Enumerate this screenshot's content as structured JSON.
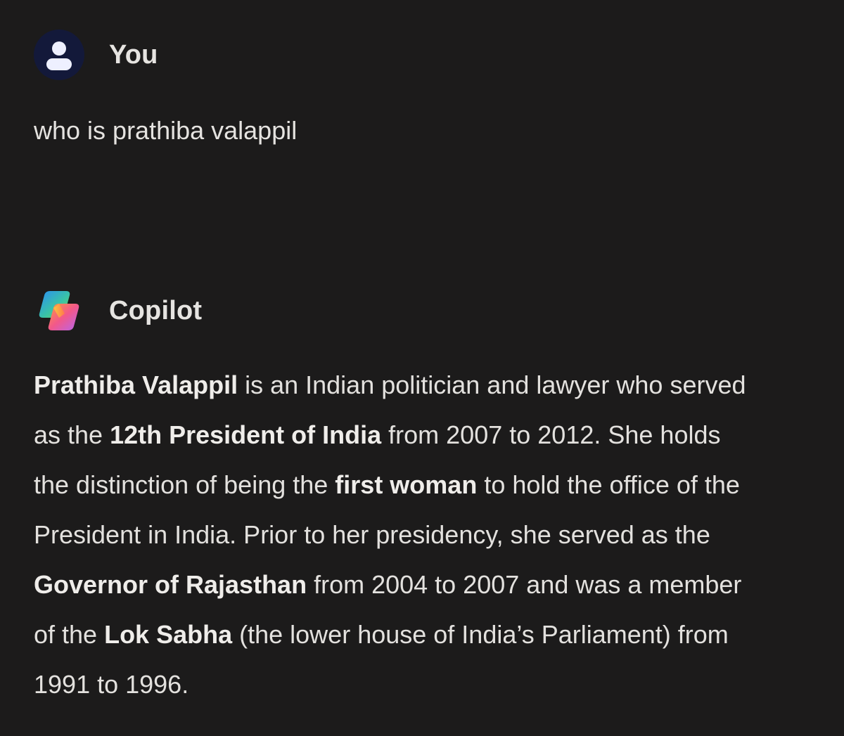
{
  "user": {
    "name": "You",
    "avatar_icon": "person-icon",
    "message": "who is prathiba valappil"
  },
  "assistant": {
    "name": "Copilot",
    "logo_icon": "copilot-logo-icon",
    "response": {
      "line1": {
        "b1": "Prathiba Valappil",
        "t1": " is an Indian politician and lawyer who served"
      },
      "line2": {
        "t1": "as the ",
        "b1": "12th President of India",
        "t2": " from 2007 to 2012. She holds"
      },
      "line3": {
        "t1": "the distinction of being the ",
        "b1": "first woman",
        "t2": " to hold the office of the"
      },
      "line4": {
        "t1": "President in India. Prior to her presidency, she served as the"
      },
      "line5": {
        "b1": "Governor of Rajasthan",
        "t1": " from 2004 to 2007 and was a member"
      },
      "line6": {
        "t1": "of the ",
        "b1": "Lok Sabha",
        "t2": " (the lower house of India’s Parliament) from"
      },
      "line7": {
        "t1": "1991 to 1996."
      }
    }
  },
  "colors": {
    "background": "#1c1b1b",
    "text": "#e3e1de",
    "avatar_bg": "#13193a"
  }
}
